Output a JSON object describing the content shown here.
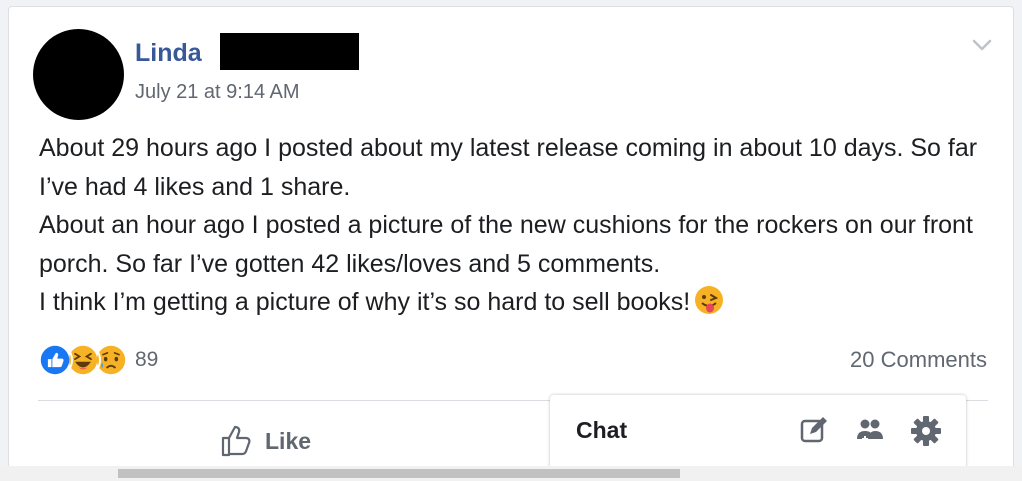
{
  "post": {
    "author": "Linda",
    "timestamp": "July 21 at 9:14 AM",
    "menu_icon": "chevron-down-icon",
    "body": [
      "About 29 hours ago I posted about my latest release coming in about 10 days. So far I’ve had 4 likes and 1 share.",
      "About an hour ago I posted a picture of the new cushions for the rockers on our front porch. So far I’ve gotten 42 likes/loves and 5 comments.",
      "I think I’m getting a picture of why it’s so hard to sell books!"
    ],
    "trailing_emoji": "tongue-out-emoji"
  },
  "reactions": {
    "icons": [
      "like-reaction-icon",
      "haha-reaction-icon",
      "sad-reaction-icon"
    ],
    "count": "89"
  },
  "comments_link": "20 Comments",
  "actions": {
    "like_label": "Like"
  },
  "chat": {
    "title": "Chat",
    "icons": [
      "compose-icon",
      "create-group-icon",
      "settings-gear-icon"
    ]
  },
  "colors": {
    "name_blue": "#385898",
    "text": "#1c1e21",
    "secondary": "#606770",
    "like_blue": "#1877f2"
  }
}
